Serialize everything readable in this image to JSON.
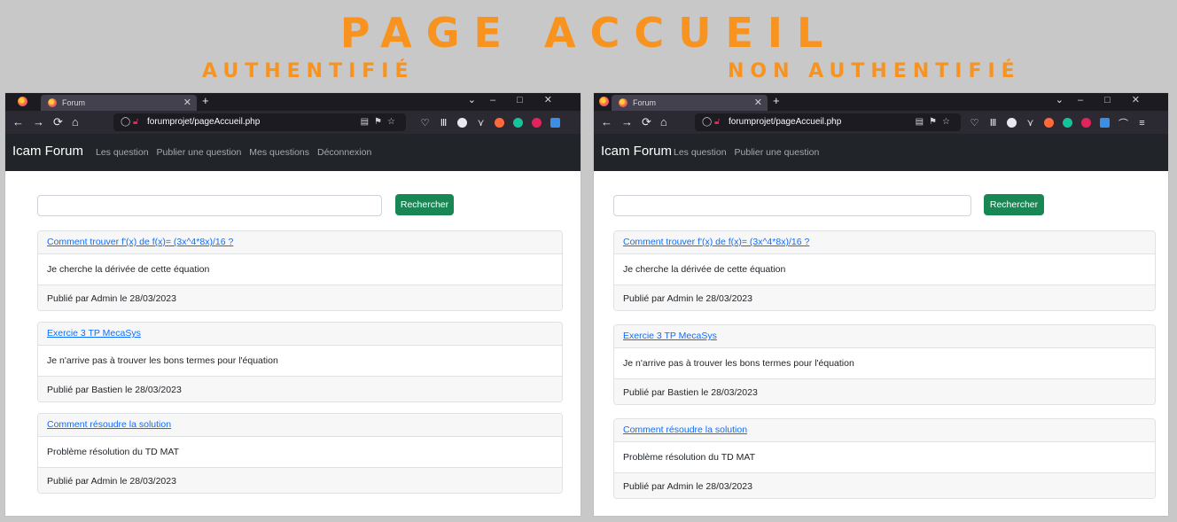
{
  "header": {
    "title": "PAGE ACCUEIL",
    "left_label": "AUTHENTIFIÉ",
    "right_label": "NON AUTHENTIFIÉ"
  },
  "browser": {
    "tab_title": "Forum",
    "url": "forumprojet/pageAccueil.php"
  },
  "left": {
    "brand": "Icam Forum",
    "nav": [
      "Les question",
      "Publier une question",
      "Mes questions",
      "Déconnexion"
    ],
    "search_button": "Rechercher",
    "posts": [
      {
        "title": "Comment trouver f'(x) de f(x)= (3x^4*8x)/16 ?",
        "body": "Je cherche la dérivée de cette équation",
        "footer": "Publié par Admin le 28/03/2023"
      },
      {
        "title": "Exercie 3 TP MecaSys",
        "body": "Je n'arrive pas à trouver les bons termes pour l'équation",
        "footer": "Publié par Bastien le 28/03/2023"
      },
      {
        "title": "Comment résoudre la solution",
        "body": "Problème résolution du TD MAT",
        "footer": "Publié par Admin le 28/03/2023"
      }
    ]
  },
  "right": {
    "brand": "Icam Forum",
    "nav": [
      "Les question",
      "Publier une question"
    ],
    "search_button": "Rechercher",
    "posts": [
      {
        "title": "Comment trouver f'(x) de f(x)= (3x^4*8x)/16 ?",
        "body": "Je cherche la dérivée de cette équation",
        "footer": "Publié par Admin le 28/03/2023"
      },
      {
        "title": "Exercie 3 TP MecaSys",
        "body": "Je n'arrive pas à trouver les bons termes pour l'équation",
        "footer": "Publié par Bastien le 28/03/2023"
      },
      {
        "title": "Comment résoudre la solution",
        "body": "Problème résolution du TD MAT",
        "footer": "Publié par Admin le 28/03/2023"
      }
    ]
  },
  "colors": {
    "accent_orange": "#f7931e",
    "navbar": "#212529",
    "success": "#198754",
    "link": "#0d6efd"
  },
  "icons": {
    "nav": [
      "back-icon",
      "forward-icon",
      "reload-icon",
      "home-icon"
    ],
    "extensions": [
      "pocket-icon",
      "library-icon",
      "extension-icon",
      "addon-icon",
      "ublock-icon",
      "grammarly-icon",
      "extension-icon",
      "translate-icon",
      "account-icon",
      "menu-icon"
    ]
  }
}
